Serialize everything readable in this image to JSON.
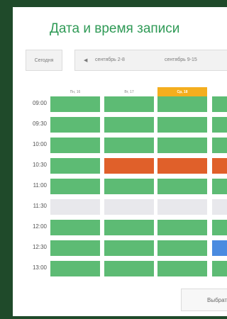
{
  "title": "Дата и время записи",
  "nav": {
    "today_label": "Сегодня",
    "prev_week_label": "сентябрь 2-8",
    "current_week_label": "сентябрь 9-15"
  },
  "days": [
    {
      "label": "Пн, 16",
      "active": false
    },
    {
      "label": "Вт, 17",
      "active": false
    },
    {
      "label": "Ср, 18",
      "active": true
    },
    {
      "label": "",
      "active": false
    }
  ],
  "times": [
    "09:00",
    "09:30",
    "10:00",
    "10:30",
    "11:00",
    "11:30",
    "12:00",
    "12:30",
    "13:00"
  ],
  "slots": [
    [
      "free",
      "free",
      "free",
      "free"
    ],
    [
      "free",
      "free",
      "free",
      "free"
    ],
    [
      "free",
      "free",
      "free",
      "free"
    ],
    [
      "free",
      "busy",
      "busy",
      "busy"
    ],
    [
      "free",
      "free",
      "free",
      "free"
    ],
    [
      "disabled",
      "disabled",
      "disabled",
      "disabled"
    ],
    [
      "free",
      "free",
      "free",
      "free"
    ],
    [
      "free",
      "free",
      "free",
      "selected"
    ],
    [
      "free",
      "free",
      "free",
      "free"
    ]
  ],
  "colors": {
    "free": "#5dbb74",
    "busy": "#e0602a",
    "disabled": "#e8e8ec",
    "selected": "#4a8be0",
    "active_day": "#f4ae1e",
    "title": "#2f9a56",
    "background": "#1f4a2a"
  },
  "select_button_label": "Выбрать",
  "icons": {
    "prev_week": "chevron-left-icon"
  }
}
